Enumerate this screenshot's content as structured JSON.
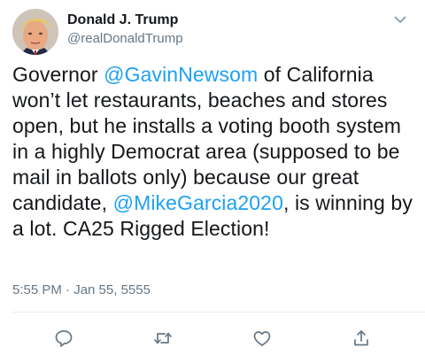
{
  "user": {
    "display_name": "Donald J. Trump",
    "handle": "@realDonaldTrump"
  },
  "tweet": {
    "segments": [
      {
        "text": "Governor ",
        "type": "text"
      },
      {
        "text": "@GavinNewsom",
        "type": "mention"
      },
      {
        "text": " of California won’t let restaurants, beaches and stores open, but he installs a voting booth system in a highly Democrat area (supposed to be mail in ballots only) because our great candidate, ",
        "type": "text"
      },
      {
        "text": "@MikeGarcia2020",
        "type": "mention"
      },
      {
        "text": ", is winning by a lot. CA25 Rigged Election!",
        "type": "text"
      }
    ],
    "timestamp": "5:55 PM · Jan 55, 5555"
  },
  "actions": {
    "icons": [
      "reply-icon",
      "retweet-icon",
      "like-icon",
      "share-icon"
    ]
  },
  "colors": {
    "mention": "#1da1f2",
    "secondary_text": "#657786",
    "primary_text": "#14171a",
    "icon": "#657786",
    "divider": "#e6ecf0"
  }
}
